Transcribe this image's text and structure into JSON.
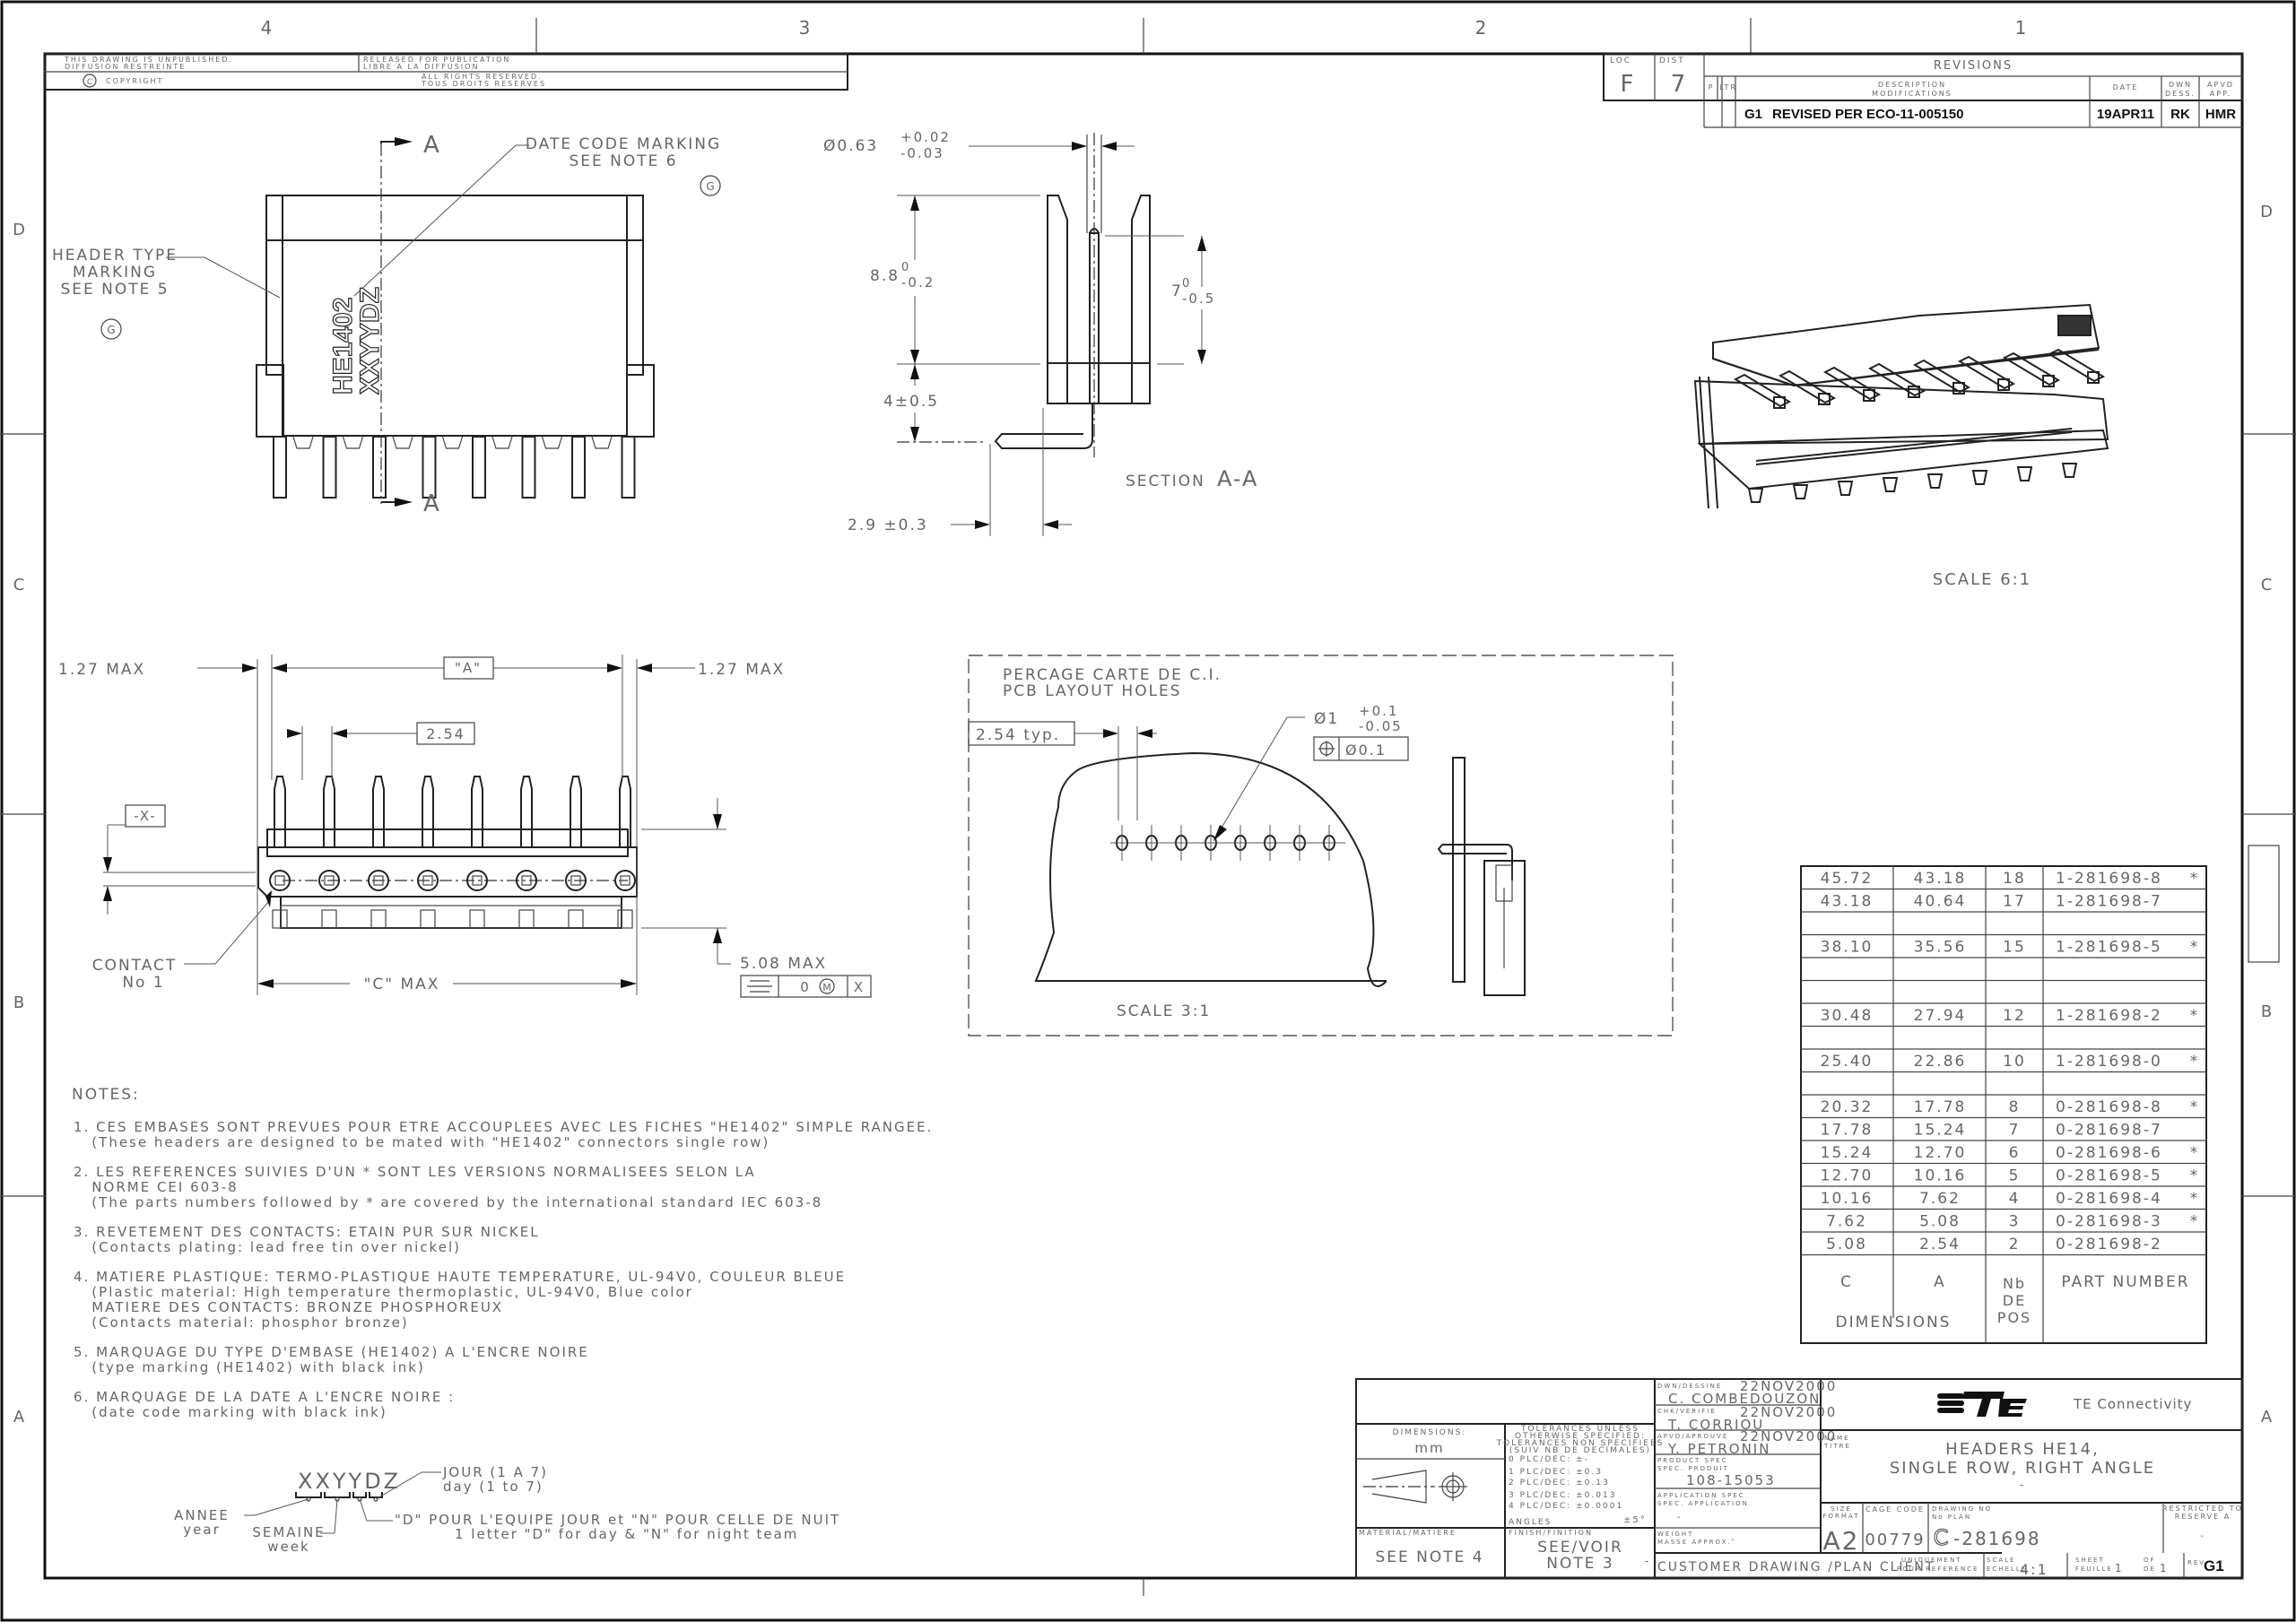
{
  "border": {
    "columns": [
      "4",
      "3",
      "2",
      "1"
    ],
    "rows": [
      "D",
      "C",
      "B",
      "A"
    ]
  },
  "legal_block": {
    "unpublished_en": "THIS DRAWING IS UNPUBLISHED.",
    "unpublished_fr": "DIFFUSION RESTREINTE",
    "released_en": "RELEASED FOR PUBLICATION",
    "released_fr": "LIBRE A LA DIFFUSION",
    "copyright_symbol": "C",
    "copyright": "COPYRIGHT",
    "rights_en": "ALL RIGHTS RESERVED.",
    "rights_fr": "TOUS DROITS RESERVES"
  },
  "loc_dist": {
    "loc_label": "LOC",
    "loc_value": "F",
    "dist_label": "DIST",
    "dist_value": "7"
  },
  "revisions": {
    "title": "REVISIONS",
    "headers": {
      "p": "P",
      "ltr": "LTR",
      "desc1": "DESCRIPTION",
      "desc2": "MODIFICATIONS",
      "date": "DATE",
      "dwn1": "DWN",
      "dwn2": "DESS.",
      "apvd1": "APVD",
      "apvd2": "APP."
    },
    "rows": [
      {
        "ltr": "G1",
        "description": "REVISED PER ECO-11-005150",
        "date": "19APR11",
        "dwn": "RK",
        "apvd": "HMR"
      }
    ]
  },
  "front_view": {
    "section_letter_top": "A",
    "section_letter_bottom": "A",
    "date_code_label_1": "DATE CODE MARKING",
    "date_code_label_2": "SEE NOTE 6",
    "header_type_label_1": "HEADER TYPE",
    "header_type_label_2": "MARKING",
    "header_type_label_3": "SEE NOTE 5",
    "rev_flag": "G",
    "marking_text": "HE1402",
    "date_code_text": "XXYYDZ",
    "pin_count": 8
  },
  "section_view": {
    "title_prefix": "SECTION",
    "title_letters": "A-A",
    "dia_label": "Ø0.63",
    "dia_tol_plus": "+0.02",
    "dia_tol_minus": "-0.03",
    "height_main": "8.8",
    "height_tol_upper": "0",
    "height_tol_lower": "-0.2",
    "pin_height": "7",
    "pin_tol_upper": "0",
    "pin_tol_lower": "-0.5",
    "offset": "4±0.5",
    "tail": "2.9 ±0.3"
  },
  "iso_view": {
    "scale": "SCALE 6:1"
  },
  "bottom_view": {
    "left_max": "1.27 MAX",
    "right_max": "1.27 MAX",
    "dim_a": "\"A\"",
    "pitch": "2.54",
    "datum": "-X-",
    "contact_1": "CONTACT",
    "contact_2": "No 1",
    "dim_c": "\"C\" MAX",
    "height_max": "5.08 MAX",
    "fcf_value": "0",
    "fcf_modifier": "M",
    "fcf_datum": "X",
    "pin_count": 8
  },
  "pcb_view": {
    "title_fr": "PERCAGE CARTE DE C.I.",
    "title_en": "PCB LAYOUT HOLES",
    "pitch_typ": "2.54 typ.",
    "hole_dia": "Ø1",
    "hole_tol_plus": "+0.1",
    "hole_tol_minus": "-0.05",
    "position_tol": "Ø0.1",
    "scale": "SCALE 3:1",
    "hole_count": 8
  },
  "part_table": {
    "rows": [
      {
        "c": "45.72",
        "a": "43.18",
        "pos": "18",
        "part": "1-281698-8",
        "star": "*"
      },
      {
        "c": "43.18",
        "a": "40.64",
        "pos": "17",
        "part": "1-281698-7",
        "star": ""
      },
      {
        "c": "",
        "a": "",
        "pos": "",
        "part": "",
        "star": ""
      },
      {
        "c": "38.10",
        "a": "35.56",
        "pos": "15",
        "part": "1-281698-5",
        "star": "*"
      },
      {
        "c": "",
        "a": "",
        "pos": "",
        "part": "",
        "star": ""
      },
      {
        "c": "",
        "a": "",
        "pos": "",
        "part": "",
        "star": ""
      },
      {
        "c": "30.48",
        "a": "27.94",
        "pos": "12",
        "part": "1-281698-2",
        "star": "*"
      },
      {
        "c": "",
        "a": "",
        "pos": "",
        "part": "",
        "star": ""
      },
      {
        "c": "25.40",
        "a": "22.86",
        "pos": "10",
        "part": "1-281698-0",
        "star": "*"
      },
      {
        "c": "",
        "a": "",
        "pos": "",
        "part": "",
        "star": ""
      },
      {
        "c": "20.32",
        "a": "17.78",
        "pos": "8",
        "part": "0-281698-8",
        "star": "*"
      },
      {
        "c": "17.78",
        "a": "15.24",
        "pos": "7",
        "part": "0-281698-7",
        "star": ""
      },
      {
        "c": "15.24",
        "a": "12.70",
        "pos": "6",
        "part": "0-281698-6",
        "star": "*"
      },
      {
        "c": "12.70",
        "a": "10.16",
        "pos": "5",
        "part": "0-281698-5",
        "star": "*"
      },
      {
        "c": "10.16",
        "a": "7.62",
        "pos": "4",
        "part": "0-281698-4",
        "star": "*"
      },
      {
        "c": "7.62",
        "a": "5.08",
        "pos": "3",
        "part": "0-281698-3",
        "star": "*"
      },
      {
        "c": "5.08",
        "a": "2.54",
        "pos": "2",
        "part": "0-281698-2",
        "star": ""
      }
    ],
    "header_c": "C",
    "header_a": "A",
    "header_nb": "Nb",
    "header_de": "DE",
    "header_pos": "POS",
    "header_part": "PART NUMBER",
    "header_dimensions": "DIMENSIONS"
  },
  "notes": {
    "title": "NOTES:",
    "items": [
      {
        "lines": [
          "1. CES EMBASES SONT PREVUES POUR ETRE ACCOUPLEES AVEC LES FICHES \"HE1402\" SIMPLE RANGEE.",
          "   (These headers are designed to be mated with \"HE1402\" connectors single row)"
        ]
      },
      {
        "lines": [
          "2. LES REFERENCES SUIVIES D'UN * SONT LES VERSIONS NORMALISEES SELON LA",
          "   NORME CEI 603-8",
          "   (The parts numbers followed by * are covered by the international standard IEC 603-8"
        ]
      },
      {
        "lines": [
          "3. REVETEMENT DES CONTACTS: ETAIN PUR SUR NICKEL",
          "   (Contacts plating: lead free tin over nickel)"
        ]
      },
      {
        "lines": [
          "4. MATIERE PLASTIQUE: TERMO-PLASTIQUE HAUTE TEMPERATURE, UL-94V0, COULEUR BLEUE",
          "   (Plastic material: High temperature thermoplastic, UL-94V0, Blue color",
          "   MATIERE DES CONTACTS: BRONZE PHOSPHOREUX",
          "   (Contacts material: phosphor bronze)"
        ]
      },
      {
        "lines": [
          "5. MARQUAGE DU TYPE D'EMBASE (HE1402) A L'ENCRE NOIRE",
          "   (type marking (HE1402) with black ink)"
        ]
      },
      {
        "lines": [
          "6. MARQUAGE DE LA DATE A L'ENCRE NOIRE :",
          "   (date code marking with black ink)"
        ]
      }
    ]
  },
  "date_code_diagram": {
    "code": "XXYYDZ",
    "jour_fr": "JOUR (1 A 7)",
    "jour_en": "day (1 to 7)",
    "annee_fr": "ANNEE",
    "annee_en": "year",
    "semaine_fr": "SEMAINE",
    "semaine_en": "week",
    "team_fr": "\"D\" POUR L'EQUIPE JOUR et \"N\" POUR CELLE DE NUIT",
    "team_en": "1 letter \"D\" for day & \"N\" for night team"
  },
  "title_block": {
    "dimensions_label": "DIMENSIONS:",
    "dimensions_unit": "mm",
    "tol_title": [
      "TOLERANCES UNLESS",
      "OTHERWISE SPECIFIED:",
      "TOLERANCES NON SPECIFIEES",
      "(SUIV NB DE DECIMALES)"
    ],
    "tol_lines": [
      "0 PLC/DEC: ±-",
      "1 PLC/DEC: ±0.3",
      "2 PLC/DEC: ±0.13",
      "3 PLC/DEC: ±0.013",
      "4 PLC/DEC: ±0.0001"
    ],
    "angles_label": "ANGLES",
    "angles_value": "±5°",
    "material_label": "MATERIAL/MATIERE",
    "material_value": "SEE NOTE 4",
    "finish_label": "FINISH/FINITION",
    "finish_value_1": "SEE/VOIR",
    "finish_value_2": "NOTE 3",
    "finish_dash": "-",
    "dwn_label": "DWN/DESSINE",
    "dwn_date": "22NOV2000",
    "dwn_name": "C. COMBEDOUZON",
    "chk_label": "CHK/VERIFIE",
    "chk_date": "22NOV2000",
    "chk_name": "T. CORRIOU",
    "apvd_label": "APVD/APROUVE",
    "apvd_date": "22NOV2000",
    "apvd_name": "Y. PETRONIN",
    "product_spec_1": "PRODUCT SPEC",
    "product_spec_2": "SPEC. PRODUIT",
    "product_spec_value": "108-15053",
    "app_spec_1": "APPLICATION SPEC",
    "app_spec_2": "SPEC. APPLICATION",
    "app_spec_value": "-",
    "weight_1": "WEIGHT",
    "weight_2": "MASSE APPROX.",
    "weight_value": "-",
    "customer_drawing": "CUSTOMER DRAWING   /PLAN CLIENT",
    "ref_only_1": "UNIQUEMENT",
    "ref_only_2": "POUR REFERENCE",
    "company": "TE Connectivity",
    "logo": "TE",
    "name_label_1": "NAME",
    "name_label_2": "TITRE",
    "title_1": "HEADERS HE14,",
    "title_2": "SINGLE ROW, RIGHT ANGLE",
    "title_3": "-",
    "size_label_1": "SIZE",
    "size_label_2": "FORMAT",
    "size_value": "A2",
    "cage_label": "CAGE CODE",
    "cage_value": "00779",
    "dwg_label_1": "DRAWING NO",
    "dwg_label_2": "No PLAN",
    "dwg_prefix": "C",
    "dwg_value": "-281698",
    "restricted_1": "RESTRICTED TO",
    "restricted_2": "RESERVE A",
    "restricted_value": "-",
    "scale_label_1": "SCALE",
    "scale_label_2": "ECHELLE",
    "scale_value": "4:1",
    "sheet_label_1": "SHEET",
    "sheet_label_2": "FEUILLE",
    "sheet_value": "1",
    "of_label_1": "OF",
    "of_label_2": "DE",
    "of_value": "1",
    "rev_label": "REV",
    "rev_value": "G1"
  }
}
